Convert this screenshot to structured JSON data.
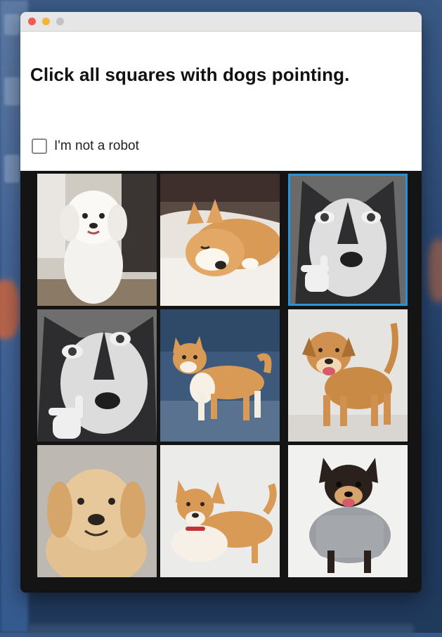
{
  "window": {
    "traffic_lights": [
      "close",
      "minimize",
      "zoom"
    ]
  },
  "captcha": {
    "prompt": "Click all squares with dogs pointing.",
    "checkbox_label": "I'm not a robot",
    "checkbox_checked": false
  },
  "tiles": [
    {
      "subject": "white poodle sitting",
      "selected": false
    },
    {
      "subject": "corgi sleeping on bed",
      "selected": false
    },
    {
      "subject": "husky pointing",
      "selected": true
    },
    {
      "subject": "husky pointing",
      "selected": false
    },
    {
      "subject": "shiba standing on blue background",
      "selected": false
    },
    {
      "subject": "tan mixed dog smiling",
      "selected": false
    },
    {
      "subject": "golden retriever portrait",
      "selected": false
    },
    {
      "subject": "corgi mix lying down",
      "selected": false
    },
    {
      "subject": "chihuahua in gray sweater",
      "selected": false
    }
  ],
  "colors": {
    "selection_border": "#2a93d5",
    "grid_background": "#141414"
  }
}
